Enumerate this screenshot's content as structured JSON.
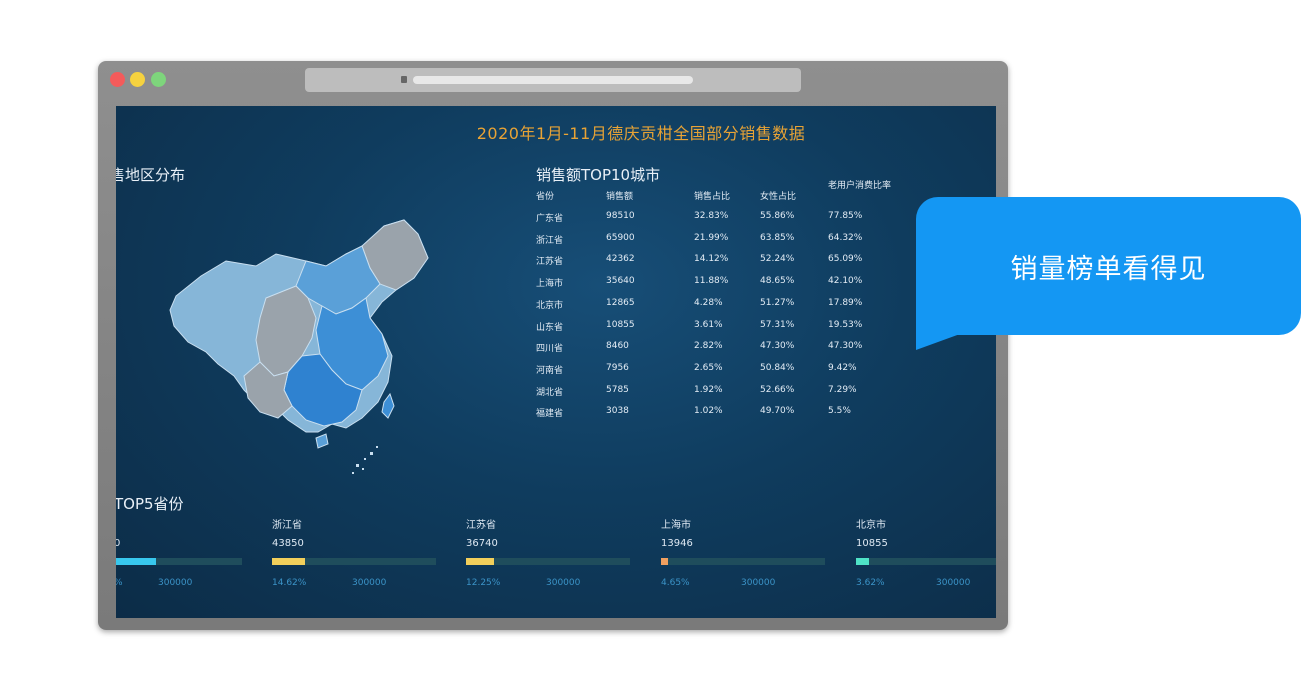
{
  "dashboard": {
    "title": "2020年1月-11月德庆贡柑全国部分销售数据",
    "map_section_title": "售地区分布",
    "top10_title": "销售额TOP10城市",
    "top5_title": "TOP5省份"
  },
  "table": {
    "headers": [
      "省份",
      "销售额",
      "销售占比",
      "女性占比",
      "老用户消费比率"
    ],
    "rows": [
      [
        "广东省",
        "98510",
        "32.83%",
        "55.86%",
        "77.85%"
      ],
      [
        "浙江省",
        "65900",
        "21.99%",
        "63.85%",
        "64.32%"
      ],
      [
        "江苏省",
        "42362",
        "14.12%",
        "52.24%",
        "65.09%"
      ],
      [
        "上海市",
        "35640",
        "11.88%",
        "48.65%",
        "42.10%"
      ],
      [
        "北京市",
        "12865",
        "4.28%",
        "51.27%",
        "17.89%"
      ],
      [
        "山东省",
        "10855",
        "3.61%",
        "57.31%",
        "19.53%"
      ],
      [
        "四川省",
        "8460",
        "2.82%",
        "47.30%",
        "47.30%"
      ],
      [
        "河南省",
        "7956",
        "2.65%",
        "50.84%",
        "9.42%"
      ],
      [
        "湖北省",
        "5785",
        "1.92%",
        "52.66%",
        "7.29%"
      ],
      [
        "福建省",
        "3038",
        "1.02%",
        "49.70%",
        "5.5%"
      ]
    ]
  },
  "provinces": [
    {
      "name": "",
      "value": "0",
      "pct": "%",
      "max": "300000",
      "fraction": 0.33,
      "color": "#38c8ee"
    },
    {
      "name": "浙江省",
      "value": "43850",
      "pct": "14.62%",
      "max": "300000",
      "fraction": 0.2,
      "color": "#f2cf5b"
    },
    {
      "name": "江苏省",
      "value": "36740",
      "pct": "12.25%",
      "max": "300000",
      "fraction": 0.17,
      "color": "#f2cf5b"
    },
    {
      "name": "上海市",
      "value": "13946",
      "pct": "4.65%",
      "max": "300000",
      "fraction": 0.045,
      "color": "#f0a060"
    },
    {
      "name": "北京市",
      "value": "10855",
      "pct": "3.62%",
      "max": "300000",
      "fraction": 0.08,
      "color": "#4fe3c7"
    }
  ],
  "bubble": {
    "text": "销量榜单看得见"
  },
  "colors": {
    "title": "#e8a335",
    "bubble": "#1497f3",
    "map_light": "#86b6d8",
    "map_dark": "#3d8fd6",
    "map_gray": "#9aa3ab"
  }
}
